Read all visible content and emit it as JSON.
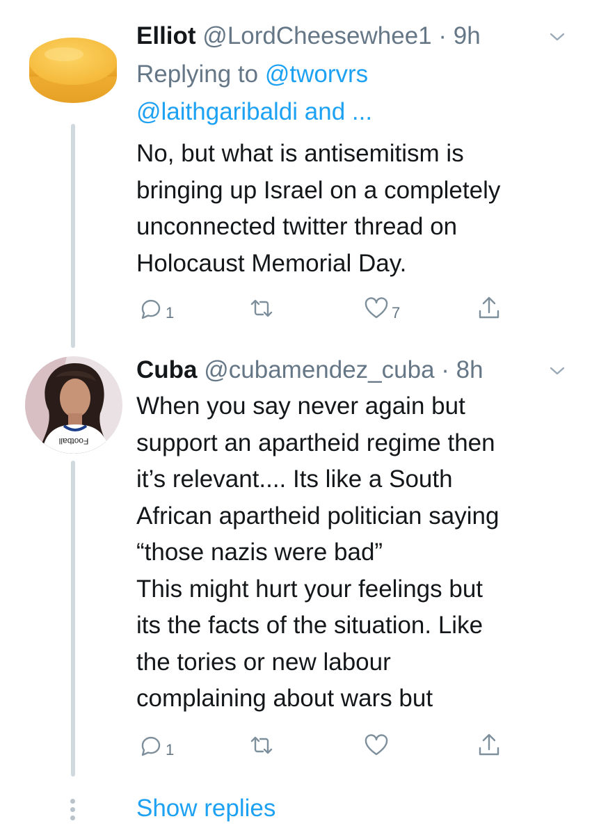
{
  "tweets": [
    {
      "name": "Elliot",
      "handle": "@LordCheesewhee1",
      "time": "· 9h",
      "replying_prefix": "Replying to",
      "replying_line1": "@tworvrs",
      "replying_line2": "@laithgaribaldi and ...",
      "text": "No, but what is antisemitism is\nbringing up Israel on a completely\nunconnected twitter thread on\nHolocaust Memorial Day.",
      "reply_count": "1",
      "like_count": "7"
    },
    {
      "name": "Cuba",
      "handle": "@cubamendez_cuba",
      "time": "· 8h",
      "text": "When you say never again but\nsupport an apartheid regime then\nit’s relevant.... Its like a South\nAfrican apartheid politician saying\n“those nazis were bad”\nThis might hurt your feelings but\nits the facts of the situation. Like\nthe tories or new labour\ncomplaining about wars but",
      "reply_count": "1",
      "avatar_shirt_text": "Football"
    }
  ],
  "show_replies_label": "Show replies",
  "colors": {
    "accent": "#1da1f2",
    "secondary_text": "#657786",
    "thread_line": "#cfd9de"
  }
}
